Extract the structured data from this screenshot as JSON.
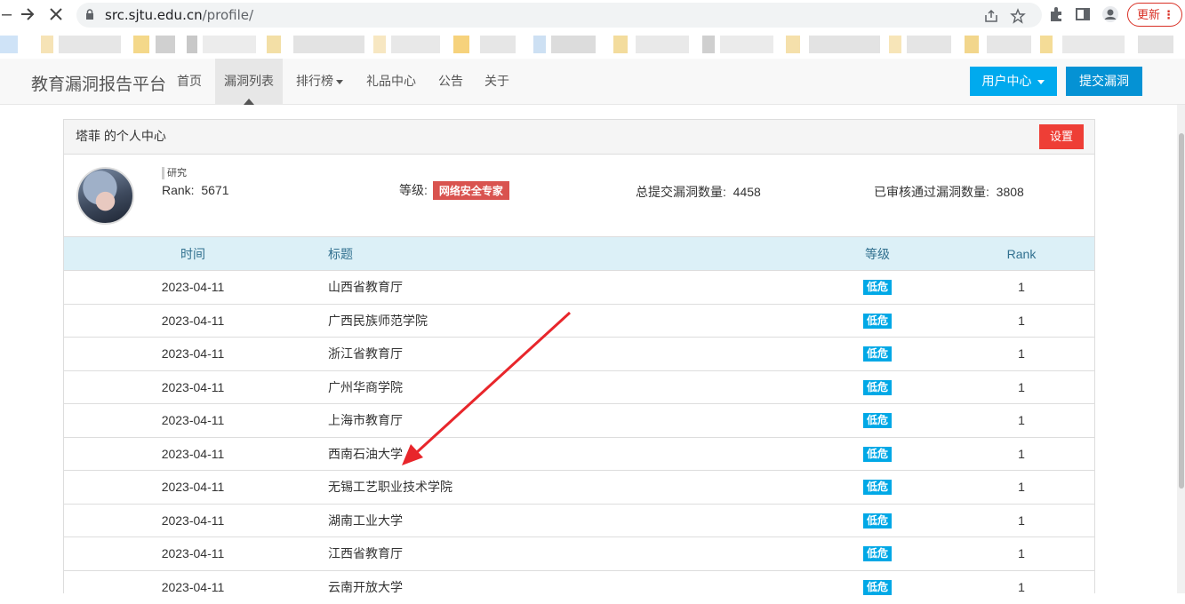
{
  "browser": {
    "url_host": "src.sjtu.edu.cn",
    "url_path": "/profile/",
    "update_label": "更新"
  },
  "navbar": {
    "brand": "教育漏洞报告平台",
    "links": [
      {
        "label": "首页"
      },
      {
        "label": "漏洞列表",
        "active": true
      },
      {
        "label": "排行榜",
        "dropdown": true
      },
      {
        "label": "礼品中心"
      },
      {
        "label": "公告"
      },
      {
        "label": "关于"
      }
    ],
    "user_center": "用户中心",
    "submit": "提交漏洞"
  },
  "profile": {
    "title": "塔菲 的个人中心",
    "settings": "设置",
    "motto": "研究",
    "rank_label": "Rank:",
    "rank": "5671",
    "level_label": "等级:",
    "level": "网络安全专家",
    "total_label": "总提交漏洞数量:",
    "total": "4458",
    "approved_label": "已审核通过漏洞数量:",
    "approved": "3808"
  },
  "table": {
    "headers": [
      "时间",
      "标题",
      "等级",
      "Rank"
    ],
    "rows": [
      {
        "time": "2023-04-11",
        "title": "山西省教育厅",
        "level": "低危",
        "rank": "1"
      },
      {
        "time": "2023-04-11",
        "title": "广西民族师范学院",
        "level": "低危",
        "rank": "1"
      },
      {
        "time": "2023-04-11",
        "title": "浙江省教育厅",
        "level": "低危",
        "rank": "1"
      },
      {
        "time": "2023-04-11",
        "title": "广州华商学院",
        "level": "低危",
        "rank": "1"
      },
      {
        "time": "2023-04-11",
        "title": "上海市教育厅",
        "level": "低危",
        "rank": "1"
      },
      {
        "time": "2023-04-11",
        "title": "西南石油大学",
        "level": "低危",
        "rank": "1"
      },
      {
        "time": "2023-04-11",
        "title": "无锡工艺职业技术学院",
        "level": "低危",
        "rank": "1"
      },
      {
        "time": "2023-04-11",
        "title": "湖南工业大学",
        "level": "低危",
        "rank": "1"
      },
      {
        "time": "2023-04-11",
        "title": "江西省教育厅",
        "level": "低危",
        "rank": "1"
      },
      {
        "time": "2023-04-11",
        "title": "云南开放大学",
        "level": "低危",
        "rank": "1"
      }
    ]
  },
  "colors": {
    "accent": "#00aaee",
    "danger": "#ee3e36",
    "level_low": "#00a8e6",
    "annotation_arrow": "#e8262b"
  }
}
